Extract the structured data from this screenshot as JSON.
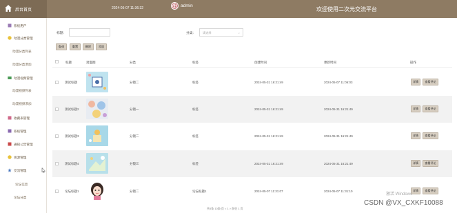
{
  "header": {
    "brand": "后台首页",
    "datetime": "2024-05-07 11:36:32",
    "admin": "admin",
    "welcome": "欢迎使用二次元交流平台"
  },
  "sidebar": {
    "items": [
      {
        "label": "系统用户",
        "icon": "user-group-icon",
        "sub": false
      },
      {
        "label": "动漫分类管理",
        "icon": "folder-icon",
        "sub": false
      },
      {
        "label": "动漫分类列表",
        "sub": true
      },
      {
        "label": "动漫分类添加",
        "sub": true
      },
      {
        "label": "动漫视频管理",
        "icon": "video-icon",
        "sub": false
      },
      {
        "label": "动漫视频列表",
        "sub": true
      },
      {
        "label": "动漫视频添加",
        "sub": true
      },
      {
        "label": "收藏表管理",
        "icon": "bookmark-icon",
        "sub": false
      },
      {
        "label": "系统管理",
        "icon": "gear-icon",
        "sub": false
      },
      {
        "label": "通知公告管理",
        "icon": "notice-icon",
        "sub": false
      },
      {
        "label": "资源管理",
        "icon": "resource-icon",
        "sub": false
      },
      {
        "label": "交流管理",
        "icon": "star-icon",
        "sub": false
      },
      {
        "label": "论坛信息",
        "sub": true
      },
      {
        "label": "论坛分类",
        "sub": true
      }
    ]
  },
  "search": {
    "title_label": "标题:",
    "title_value": "",
    "category_label": "分类:",
    "category_placeholder": "请选择"
  },
  "toolbar": {
    "query": "查询",
    "reset": "重置",
    "delete": "删除",
    "add": "添加"
  },
  "table": {
    "headers": [
      "标题",
      "封面图",
      "分类",
      "标签",
      "创建时间",
      "更新时间",
      "操作"
    ],
    "rows": [
      {
        "title": "测试标题",
        "category": "分镜二",
        "tag": "标签",
        "created": "2024-05-31 16:21:49",
        "updated": "2024-05-07 11:06:03"
      },
      {
        "title": "测试标题2",
        "category": "分镜一",
        "tag": "标签",
        "created": "2024-05-31 16:21:49",
        "updated": "2024-05-31 16:21:49"
      },
      {
        "title": "测试标题3",
        "category": "分镜二",
        "tag": "标签",
        "created": "2024-05-31 16:21:49",
        "updated": "2024-05-31 16:21:49"
      },
      {
        "title": "测试标题4",
        "category": "分镜三",
        "tag": "标签",
        "created": "2024-05-31 16:21:49",
        "updated": "2024-05-31 16:21:49"
      },
      {
        "title": "论坛标题1",
        "category": "分镜二",
        "tag": "论坛标题1",
        "created": "2024-05-07 11:31:07",
        "updated": "2024-05-07 11:31:10"
      }
    ],
    "detail_label": "详情",
    "comment_label": "查看评论"
  },
  "watermark": "CSDN @VX_CXKF10088",
  "windows_watermark": "激活 Windows",
  "pager": "共5条  10条/页  <  1  >  前往  1  页",
  "colors": {
    "header_bg": "#8e7b63",
    "brand_bg": "#7d6b55",
    "button_bg": "#d8cfc2",
    "row_alt": "#f2f2f2"
  }
}
